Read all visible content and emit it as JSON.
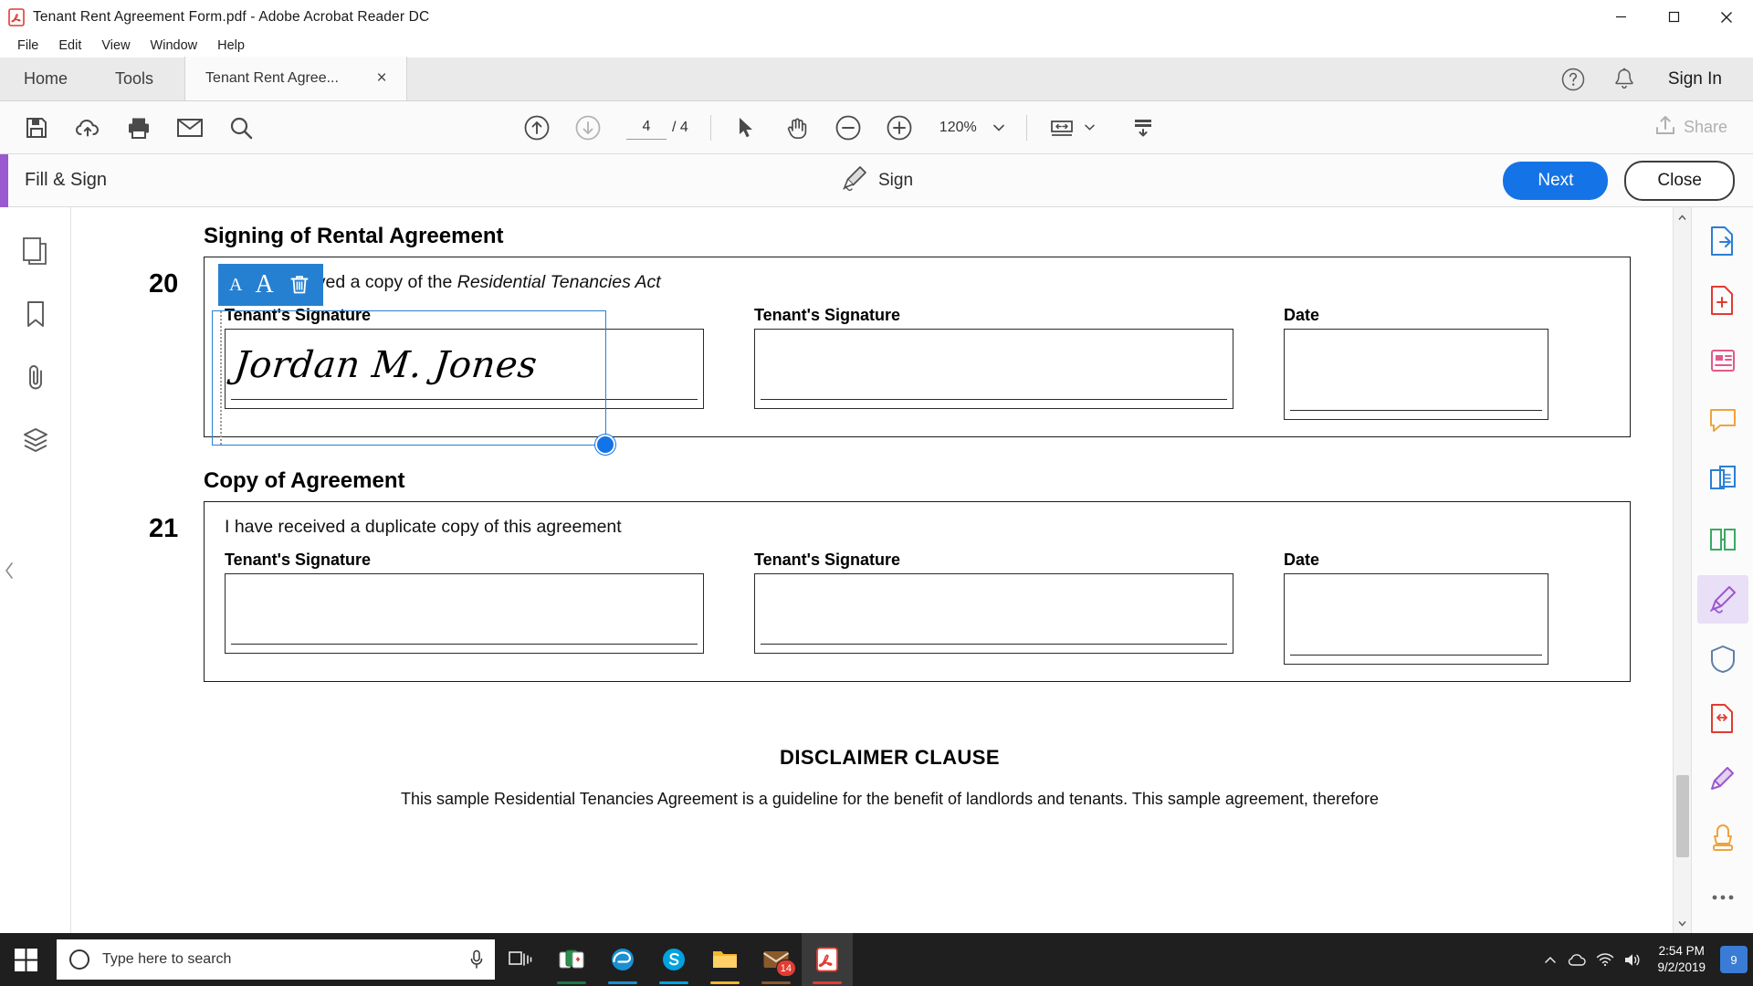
{
  "window": {
    "title": "Tenant Rent Agreement Form.pdf - Adobe Acrobat Reader DC",
    "app_icon": "pdf-file-icon",
    "minimize": "minimize-icon",
    "maximize": "maximize-icon",
    "close": "close-icon"
  },
  "menu": {
    "items": [
      "File",
      "Edit",
      "View",
      "Window",
      "Help"
    ]
  },
  "tabs": {
    "home": "Home",
    "tools": "Tools",
    "document": "Tenant Rent Agree...",
    "close_label": "×",
    "help_icon": "help-circle-icon",
    "bell_icon": "notification-bell-icon",
    "sign_in": "Sign In"
  },
  "toolbar": {
    "save_icon": "save-icon",
    "cloud_icon": "cloud-upload-icon",
    "print_icon": "print-icon",
    "email_icon": "email-icon",
    "search_icon": "search-icon",
    "prev_page_icon": "arrow-up-circle-icon",
    "next_page_icon": "arrow-down-circle-icon",
    "page_current": "4",
    "page_total": "/ 4",
    "select_icon": "cursor-select-icon",
    "hand_icon": "hand-pan-icon",
    "zoom_out_icon": "zoom-out-icon",
    "zoom_in_icon": "zoom-in-icon",
    "zoom_level": "120%",
    "zoom_caret_icon": "chevron-down-icon",
    "fit_page_icon": "fit-page-icon",
    "fit_caret_icon": "chevron-down-icon",
    "scroll_mode_icon": "page-scroll-icon",
    "share_icon": "share-icon",
    "share_label": "Share"
  },
  "fill_sign_bar": {
    "accent_color": "#9b59d0",
    "title": "Fill & Sign",
    "sign_icon": "fountain-pen-sign-icon",
    "sign_label": "Sign",
    "next_label": "Next",
    "next_color": "#1473e6",
    "close_label": "Close"
  },
  "left_rail": {
    "items": [
      {
        "name": "page-thumbnails-icon"
      },
      {
        "name": "bookmarks-icon"
      },
      {
        "name": "attachments-icon"
      },
      {
        "name": "layers-icon"
      }
    ],
    "collapse_icon": "chevron-left-icon"
  },
  "document": {
    "section_20": {
      "heading": "Signing of Rental Agreement",
      "number": "20",
      "text_prefix": "I have received a copy of the ",
      "text_italic": "Residential Tenancies Act",
      "fields": [
        {
          "label": "Tenant's Signature",
          "value": "Jordan M. Jones"
        },
        {
          "label": "Tenant's Signature",
          "value": ""
        },
        {
          "label": "Date",
          "value": ""
        }
      ]
    },
    "section_21": {
      "heading": "Copy of Agreement",
      "number": "21",
      "text": "I have received a duplicate copy of this agreement",
      "fields": [
        {
          "label": "Tenant's Signature",
          "value": ""
        },
        {
          "label": "Tenant's Signature",
          "value": ""
        },
        {
          "label": "Date",
          "value": ""
        }
      ]
    },
    "disclaimer_heading": "DISCLAIMER CLAUSE",
    "disclaimer_body": "This sample Residential Tenancies Agreement  is a guideline for the benefit of landlords and tenants. This sample agreement, therefore"
  },
  "signature_widget": {
    "value": "Jordan M. Jones",
    "border_color": "#2b7fd4",
    "handle_color": "#1473e6",
    "popup": {
      "background": "#2680d2",
      "decrease_label": "A",
      "increase_label": "A",
      "delete_icon": "trash-icon"
    }
  },
  "right_rail": {
    "items": [
      {
        "name": "export-pdf-icon",
        "color": "#2b7fd4"
      },
      {
        "name": "create-pdf-icon",
        "color": "#e03c31"
      },
      {
        "name": "edit-pdf-icon",
        "color": "#e05a8a"
      },
      {
        "name": "comment-icon",
        "color": "#f0a33a"
      },
      {
        "name": "combine-files-icon",
        "color": "#2b7fd4"
      },
      {
        "name": "organize-pages-icon",
        "color": "#3aaa64"
      },
      {
        "name": "fill-sign-icon",
        "color": "#9b59d0"
      },
      {
        "name": "protect-icon",
        "color": "#5f7fa8"
      },
      {
        "name": "compress-pdf-icon",
        "color": "#e03c31"
      },
      {
        "name": "request-signatures-icon",
        "color": "#9b59d0"
      },
      {
        "name": "stamp-icon",
        "color": "#f0a33a"
      },
      {
        "name": "more-tools-icon",
        "color": "#555555"
      }
    ],
    "active_index": 6
  },
  "scrollbar": {
    "up_arrow_icon": "chevron-up-icon",
    "down_arrow_icon": "chevron-down-icon"
  },
  "taskbar": {
    "start_icon": "windows-start-icon",
    "search_placeholder": "Type here to search",
    "mic_icon": "microphone-icon",
    "task_view_icon": "task-view-icon",
    "apps": [
      {
        "name": "solitaire-icon",
        "color": "#1a7a3c"
      },
      {
        "name": "edge-browser-icon",
        "color": "#1a8fd1"
      },
      {
        "name": "skype-icon",
        "color": "#00a3e0"
      },
      {
        "name": "file-explorer-icon",
        "color": "#f5b62c"
      },
      {
        "name": "mail-icon",
        "color": "#8a5a2b",
        "badge": "14"
      },
      {
        "name": "acrobat-reader-icon",
        "color": "#e03c31",
        "active": true
      }
    ],
    "tray": {
      "overflow_icon": "chevron-up-icon",
      "onedrive_icon": "onedrive-icon",
      "network_icon": "wifi-icon",
      "volume_icon": "speaker-icon",
      "time": "2:54 PM",
      "date": "9/2/2019",
      "action_center_badge": "9"
    }
  }
}
